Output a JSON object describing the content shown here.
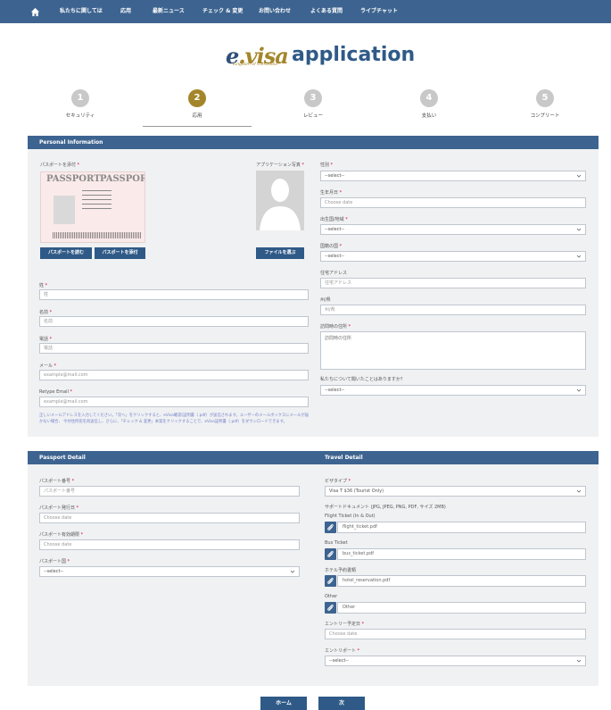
{
  "topbar": {
    "home_icon": "home-icon",
    "nav": [
      "私たちに関しては",
      "応用",
      "最新ニュース",
      "チェック & 変更",
      "お問い合わせ",
      "よくある質問",
      "ライブチャット"
    ]
  },
  "logo": {
    "e": "e",
    "visa": ".visa",
    "kingdom": "Kingdom of Cambodia",
    "application": "application"
  },
  "steps": [
    {
      "num": "1",
      "label": "セキュリティ"
    },
    {
      "num": "2",
      "label": "応用",
      "active": true
    },
    {
      "num": "3",
      "label": "レビュー"
    },
    {
      "num": "4",
      "label": "支払い"
    },
    {
      "num": "5",
      "label": "コンプリート"
    }
  ],
  "personal": {
    "header": "Personal Information",
    "passport_label": "パスポートを添付",
    "photo_label": "アプリケーション写真",
    "passport_title": "PASSPORT",
    "btn_scan": "パスポートを読む",
    "btn_attach": "パスポートを添付",
    "btn_choose": "ファイルを選ぶ",
    "surname_label": "姓",
    "surname_ph": "姓",
    "name_label": "名前",
    "name_ph": "名前",
    "phone_label": "電話",
    "phone_ph": "電話",
    "email_label": "メール",
    "email_ph": "example@mail.com",
    "retype_label": "Retype Email",
    "retype_ph": "example@mail.com",
    "gender_label": "性別",
    "gender_val": "--select--",
    "dob_label": "生年月日",
    "dob_ph": "Choose date",
    "pob_label": "出生国/地域",
    "pob_val": "--select--",
    "nationality_label": "国籍の国",
    "nationality_val": "--select--",
    "address_label": "住宅アドレス",
    "address_ph": "住宅アドレス",
    "state_label": "州/県",
    "state_ph": "州/県",
    "visit_label": "訪問時の住所",
    "visit_ph": "訪問時の住所",
    "heard_label": "私たちについて聞いたことはありますか？",
    "heard_val": "--select--",
    "note": "正しいメールアドレスを入力してください。「次へ」をクリックすると、eVisa確認(証明書（.pdf）が送信されます。ユーザーのメールボックスにメールが届かない場合、 今付住所宛を再送信し、さらに、「チェック & 変更」本案をクリックすることで、eVisa証明書（.pdf）をダウンロードできます。"
  },
  "passport_detail": {
    "header": "Passport Detail",
    "number_label": "パスポート番号",
    "number_ph": "パスポート番号",
    "issue_label": "パスポート発行日",
    "issue_ph": "Choose date",
    "expiry_label": "パスポート有効期限",
    "expiry_ph": "Choose date",
    "country_label": "パスポート国",
    "country_val": "--select--"
  },
  "travel_detail": {
    "header": "Travel Detail",
    "visa_type_label": "ビザタイプ",
    "visa_type_val": "Visa T $36 (Tourist Only)",
    "docs_label": "サポートドキュメント (JPG, JPEG, PNG, PDF, サイズ 2MB)",
    "flight_label": "Flight Ticket (In & Out)",
    "flight_file": "flight_ticket.pdf",
    "bus_label": "Bus Ticket",
    "bus_file": "bus_ticket.pdf",
    "hotel_label": "ホテル予約書類",
    "hotel_file": "hotel_reservation.pdf",
    "other_label": "Other",
    "other_file": "Other",
    "entry_date_label": "エントリー予定日",
    "entry_date_ph": "Choose date",
    "entry_port_label": "エントリポート",
    "entry_port_val": "--select--"
  },
  "footer": {
    "home_btn": "ホーム",
    "next_btn": "次"
  },
  "colors": {
    "brand_blue": "#3d6490",
    "gold": "#a4862a",
    "required": "#d04"
  }
}
